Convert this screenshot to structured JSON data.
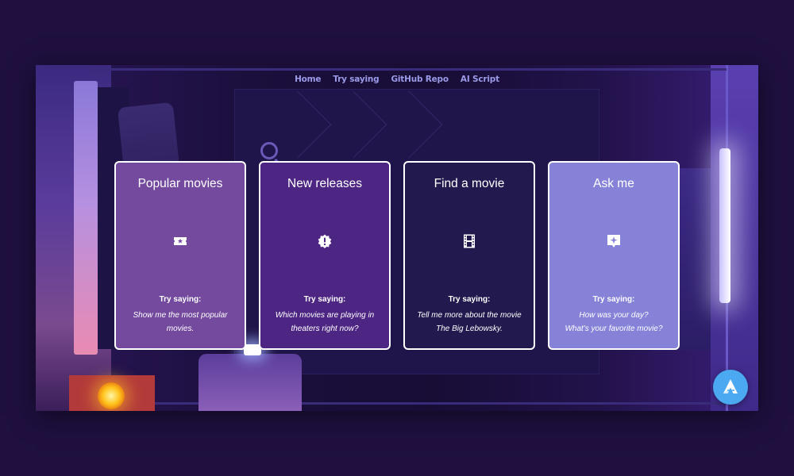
{
  "nav": {
    "items": [
      "Home",
      "Try saying",
      "GitHub Repo",
      "AI Script"
    ]
  },
  "cards": [
    {
      "title": "Popular movies",
      "icon": "ticket-icon",
      "try_label": "Try saying:",
      "example": "Show me the most popular movies."
    },
    {
      "title": "New releases",
      "icon": "exclamation-badge-icon",
      "try_label": "Try saying:",
      "example": "Which movies are playing in theaters right now?"
    },
    {
      "title": "Find a movie",
      "icon": "film-strip-icon",
      "try_label": "Try saying:",
      "example": "Tell me more about the movie The Big Lebowsky."
    },
    {
      "title": "Ask me",
      "icon": "sparkle-chat-icon",
      "try_label": "Try saying:",
      "example_line1": "How was your day?",
      "example_line2": "What's your favorite movie?"
    }
  ],
  "assistant_button": {
    "icon": "alan-logo-icon"
  },
  "colors": {
    "page_bg": "#1f1040",
    "nav_text": "#9a9ae8",
    "card1": "#744a9f",
    "card2": "#4d2583",
    "card3": "#221a4e",
    "card4": "#8582d8",
    "assistant": "#4aa9f0"
  }
}
